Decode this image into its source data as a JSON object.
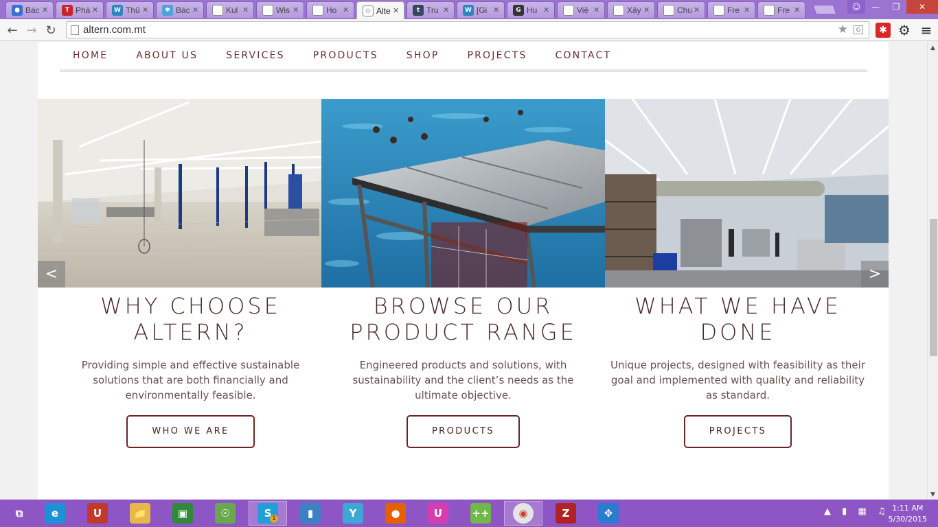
{
  "browser": {
    "tabs": [
      {
        "label": "Bác",
        "icon": "globe-icon",
        "color": "#3b6fd1"
      },
      {
        "label": "Phá",
        "icon": "t-logo-icon",
        "color": "#c8232c"
      },
      {
        "label": "Thủ",
        "icon": "wordpress-icon",
        "color": "#2e86c1"
      },
      {
        "label": "Bác",
        "icon": "asterisk-icon",
        "color": "#4fa3d8"
      },
      {
        "label": "Kul",
        "icon": "page-icon",
        "color": "#ffffff"
      },
      {
        "label": "Wis",
        "icon": "page-icon",
        "color": "#ffffff"
      },
      {
        "label": "Ho",
        "icon": "page-icon",
        "color": "#ffffff"
      },
      {
        "label": "Alte",
        "icon": "altern-icon",
        "color": "#ffffff"
      },
      {
        "label": "Tru",
        "icon": "tumblr-icon",
        "color": "#36465d"
      },
      {
        "label": "[Gi",
        "icon": "wordpress-icon",
        "color": "#2e86c1"
      },
      {
        "label": "Hu",
        "icon": "g-logo-icon",
        "color": "#333333"
      },
      {
        "label": "Việ",
        "icon": "loading-icon",
        "color": "#ffffff"
      },
      {
        "label": "Xây",
        "icon": "loading-icon",
        "color": "#ffffff"
      },
      {
        "label": "Chu",
        "icon": "loading-icon",
        "color": "#ffffff"
      },
      {
        "label": "Fre",
        "icon": "loading-icon",
        "color": "#ffffff"
      },
      {
        "label": "Fre",
        "icon": "loading-icon",
        "color": "#ffffff"
      }
    ],
    "active_tab_index": 7,
    "url": "altern.com.mt",
    "accent_color": "#9b74d2"
  },
  "site": {
    "nav": [
      "HOME",
      "ABOUT US",
      "SERVICES",
      "PRODUCTS",
      "SHOP",
      "PROJECTS",
      "CONTACT"
    ],
    "slider": {
      "prev": "<",
      "next": ">"
    },
    "columns": [
      {
        "title": "WHY CHOOSE ALTERN?",
        "text": "Providing simple and effective sustainable solutions that are both financially and environmentally feasible.",
        "button": "WHO WE ARE"
      },
      {
        "title": "BROWSE OUR PRODUCT RANGE",
        "text": "Engineered products and solutions, with sustainability and the client’s needs as the ultimate objective.",
        "button": "PRODUCTS"
      },
      {
        "title": "WHAT WE HAVE DONE",
        "text": "Unique projects, designed with feasibility as their goal and implemented with quality and reliability as standard.",
        "button": "PROJECTS"
      }
    ],
    "brand_color": "#6a2424"
  },
  "taskbar": {
    "apps": [
      {
        "name": "windows-start-icon"
      },
      {
        "name": "internet-explorer-icon"
      },
      {
        "name": "unikey-icon"
      },
      {
        "name": "file-explorer-icon"
      },
      {
        "name": "store-icon"
      },
      {
        "name": "odnoklassniki-icon"
      },
      {
        "name": "skype-icon",
        "badge": "1"
      },
      {
        "name": "book-icon"
      },
      {
        "name": "network-share-icon"
      },
      {
        "name": "firefox-icon"
      },
      {
        "name": "uc-browser-icon"
      },
      {
        "name": "notepad-plus-icon"
      },
      {
        "name": "chrome-icon"
      },
      {
        "name": "filezilla-icon"
      },
      {
        "name": "safari-icon"
      }
    ],
    "clock_time": "1:11 AM",
    "clock_date": "5/30/2015",
    "color": "#8e55c4"
  }
}
